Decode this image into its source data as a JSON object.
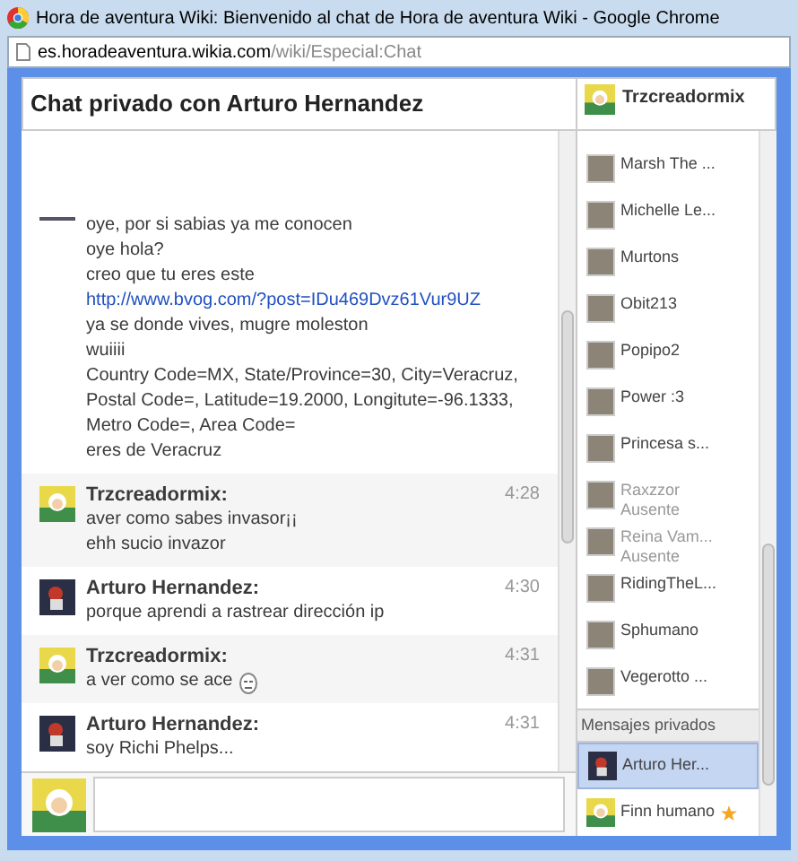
{
  "window": {
    "title": "Hora de aventura Wiki: Bienvenido al chat de Hora de aventura Wiki - Google Chrome"
  },
  "address": {
    "host": "es.horadeaventura.wikia.com",
    "path": "/wiki/Especial:Chat"
  },
  "header": {
    "title": "Chat privado con Arturo Hernandez",
    "user": "Trzcreadormix"
  },
  "messages": [
    {
      "own": false,
      "lines": [
        {
          "text": "oye, por si sabias ya me conocen"
        },
        {
          "text": "oye hola?"
        },
        {
          "text": "creo que tu eres este ",
          "link": "http://www.bvog.com/?post=IDu469Dvz61Vur9UZ"
        },
        {
          "text": "ya se donde vives, mugre moleston"
        },
        {
          "text": "wuiiii"
        },
        {
          "text": "Country Code=MX, State/Province=30, City=Veracruz, Postal Code=, Latitude=19.2000, Longitute=-96.1333, Metro Code=, Area Code="
        },
        {
          "text": "eres de Veracruz"
        }
      ]
    },
    {
      "author": "Trzcreadormix:",
      "time": "4:28",
      "own": true,
      "lines": [
        {
          "text": "aver como sabes invasor¡¡"
        },
        {
          "text": "ehh sucio invazor"
        }
      ]
    },
    {
      "author": "Arturo Hernandez:",
      "time": "4:30",
      "own": false,
      "lines": [
        {
          "text": "porque aprendi a rastrear dirección ip"
        }
      ]
    },
    {
      "author": "Trzcreadormix:",
      "time": "4:31",
      "own": true,
      "lines": [
        {
          "text": "a ver como se ace",
          "emoticon": true
        }
      ]
    },
    {
      "author": "Arturo Hernandez:",
      "time": "4:31",
      "own": false,
      "lines": [
        {
          "text": "soy Richi Phelps..."
        }
      ]
    }
  ],
  "users": [
    {
      "name": "Marsh The ..."
    },
    {
      "name": "Michelle Le..."
    },
    {
      "name": "Murtons"
    },
    {
      "name": "Obit213"
    },
    {
      "name": "Popipo2"
    },
    {
      "name": "Power :3"
    },
    {
      "name": "Princesa s..."
    },
    {
      "name": "Raxzzor",
      "status": "Ausente"
    },
    {
      "name": "Reina Vam...",
      "status": "Ausente"
    },
    {
      "name": "RidingTheL..."
    },
    {
      "name": "Sphumano"
    },
    {
      "name": "Vegerotto ..."
    }
  ],
  "private": {
    "heading": "Mensajes privados",
    "items": [
      {
        "name": "Arturo Her...",
        "selected": true,
        "starred": false
      },
      {
        "name": "Finn humano",
        "selected": false,
        "starred": true
      }
    ]
  }
}
